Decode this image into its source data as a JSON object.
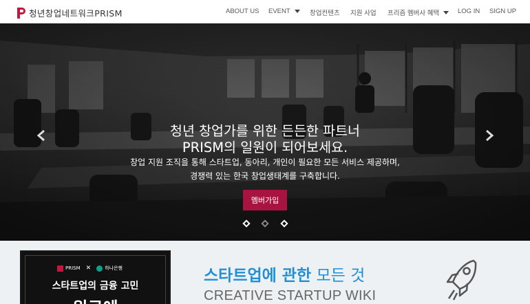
{
  "header": {
    "logo_text": "청년창업네트워크PRISM",
    "nav": [
      {
        "label": "ABOUT US"
      },
      {
        "label": "EVENT"
      },
      {
        "label": "창업컨텐츠"
      },
      {
        "label": "지원 사업"
      },
      {
        "label": "프리즘 멤버사 혜택"
      },
      {
        "label": "LOG IN"
      },
      {
        "label": "SIGN UP"
      }
    ]
  },
  "hero": {
    "title_line1": "청년 창업가를 위한 든든한 파트너",
    "title_line2": "PRISM의 일원이 되어보세요.",
    "desc_line1": "창업 지원 조직을 통해 스타트업, 동아리, 개인이 필요한 모든 서비스 제공하며,",
    "desc_line2": "경쟁력 있는 한국 창업생태계를 구축합니다.",
    "cta_label": "멤버가입",
    "slide_count": 3,
    "active_slide": 1
  },
  "promo_card": {
    "logo_left": "PRISM",
    "logo_right": "하나은행",
    "title": "스타트업의 금융 고민",
    "big_text": "원큐에"
  },
  "wiki": {
    "heading_highlight": "스타트업에 관한",
    "heading_rest": " 모든 것",
    "subtitle": "CREATIVE STARTUP WIKI"
  },
  "colors": {
    "brand": "#c4163e",
    "cta": "#a8133f",
    "wiki_blue": "#1f8fd6"
  }
}
